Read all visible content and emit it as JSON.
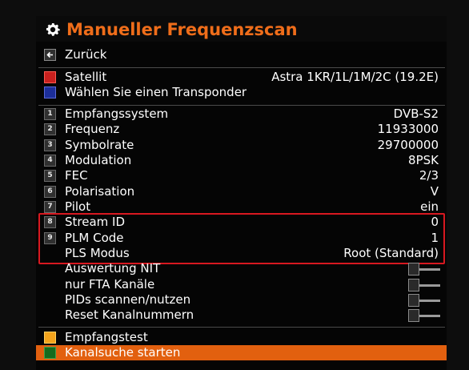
{
  "header": {
    "title": "Manueller Frequenzscan",
    "icon": "gear-icon"
  },
  "back": {
    "label": "Zurück",
    "icon": "back-arrow-icon"
  },
  "satellite": {
    "label": "Satellit",
    "value": "Astra 1KR/1L/1M/2C (19.2E)",
    "color": "#c8201e",
    "transponder_label": "Wählen Sie einen Transponder",
    "transponder_color": "#1c2e9a"
  },
  "params": [
    {
      "key": "1",
      "label": "Empfangssystem",
      "value": "DVB-S2"
    },
    {
      "key": "2",
      "label": "Frequenz",
      "value": "11933000"
    },
    {
      "key": "3",
      "label": "Symbolrate",
      "value": "29700000"
    },
    {
      "key": "4",
      "label": "Modulation",
      "value": "8PSK"
    },
    {
      "key": "5",
      "label": "FEC",
      "value": "2/3"
    },
    {
      "key": "6",
      "label": "Polarisation",
      "value": "V"
    },
    {
      "key": "7",
      "label": "Pilot",
      "value": "ein"
    },
    {
      "key": "8",
      "label": "Stream ID",
      "value": "0"
    },
    {
      "key": "9",
      "label": "PLM Code",
      "value": "1"
    },
    {
      "key": "",
      "label": "PLS Modus",
      "value": "Root (Standard)"
    }
  ],
  "options": [
    {
      "label": "Auswertung NIT",
      "state": "off"
    },
    {
      "label": "nur FTA Kanäle",
      "state": "off"
    },
    {
      "label": "PIDs scannen/nutzen",
      "state": "off"
    },
    {
      "label": "Reset Kanalnummern",
      "state": "off"
    }
  ],
  "actions": {
    "test_label": "Empfangstest",
    "test_color": "#f4a41c",
    "start_label": "Kanalsuche starten",
    "start_color": "#156b1e",
    "selected_color": "#e2600f"
  },
  "accent_color": "#ef6d1a",
  "highlight_color": "#d81820"
}
